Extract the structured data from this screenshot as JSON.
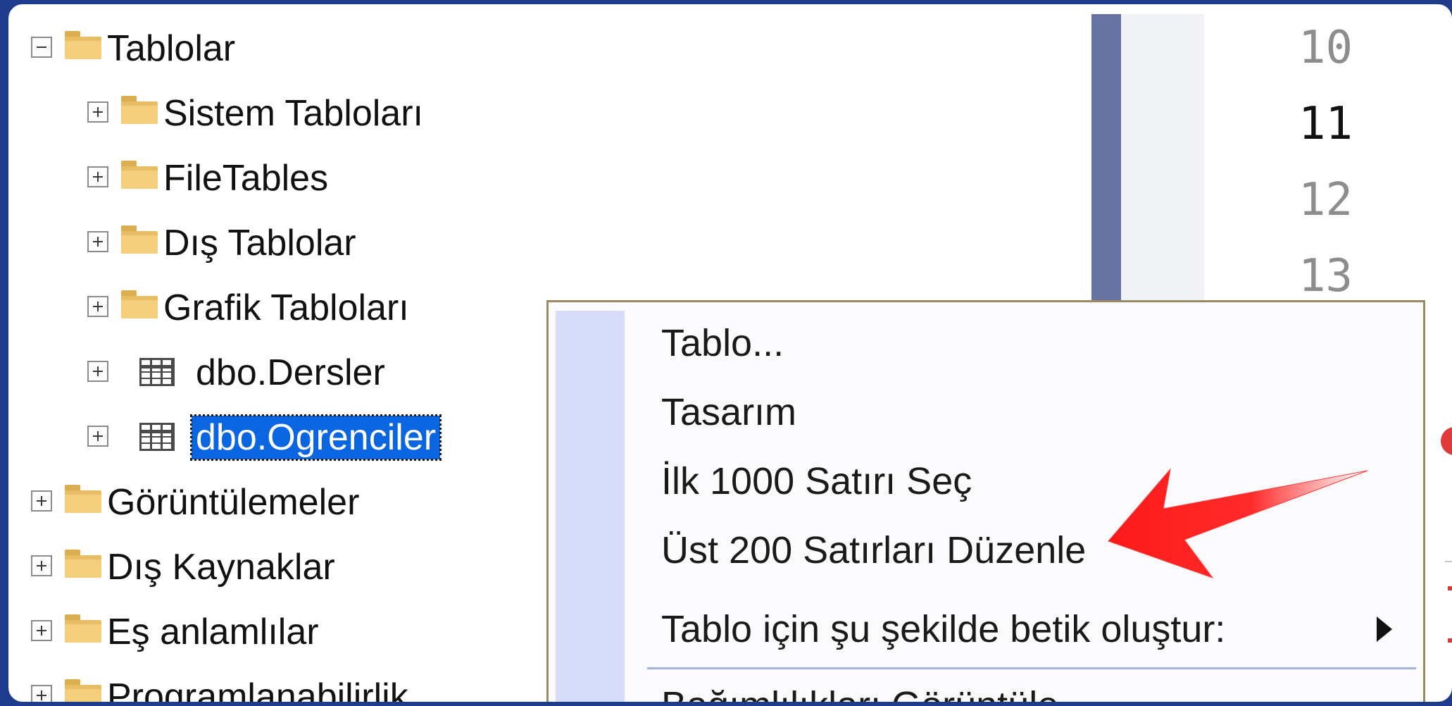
{
  "tree": {
    "root_folder": "Tablolar",
    "children": [
      "Sistem Tabloları",
      "FileTables",
      "Dış Tablolar",
      "Grafik Tabloları"
    ],
    "tables": [
      "dbo.Dersler",
      "dbo.Ogrenciler"
    ],
    "siblings": [
      "Görüntülemeler",
      "Dış Kaynaklar",
      "Eş anlamlılar",
      "Programlanabilirlik"
    ]
  },
  "editor": {
    "line_numbers": [
      "10",
      "11",
      "12",
      "13"
    ]
  },
  "context_menu": {
    "items": [
      "Tablo...",
      "Tasarım",
      "İlk 1000 Satırı Seç",
      "Üst 200 Satırları Düzenle",
      "Tablo için şu şekilde betik oluştur:",
      "Bağımlılıkları Görüntüle"
    ]
  },
  "colors": {
    "selection": "#0a66e0",
    "arrow": "#ff1a1a",
    "border": "#1f3b8c"
  }
}
